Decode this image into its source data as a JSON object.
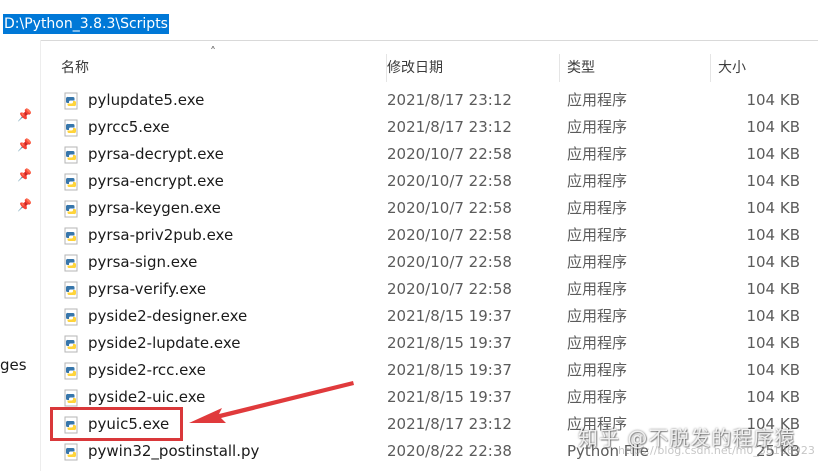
{
  "address_bar": {
    "path": "D:\\Python_3.8.3\\Scripts"
  },
  "nav": {
    "partial_label": "ges"
  },
  "columns": {
    "name": "名称",
    "date": "修改日期",
    "type": "类型",
    "size": "大小"
  },
  "files": [
    {
      "name": "pylupdate5.exe",
      "date": "2021/8/17 23:12",
      "type": "应用程序",
      "size": "104 KB"
    },
    {
      "name": "pyrcc5.exe",
      "date": "2021/8/17 23:12",
      "type": "应用程序",
      "size": "104 KB"
    },
    {
      "name": "pyrsa-decrypt.exe",
      "date": "2020/10/7 22:58",
      "type": "应用程序",
      "size": "104 KB"
    },
    {
      "name": "pyrsa-encrypt.exe",
      "date": "2020/10/7 22:58",
      "type": "应用程序",
      "size": "104 KB"
    },
    {
      "name": "pyrsa-keygen.exe",
      "date": "2020/10/7 22:58",
      "type": "应用程序",
      "size": "104 KB"
    },
    {
      "name": "pyrsa-priv2pub.exe",
      "date": "2020/10/7 22:58",
      "type": "应用程序",
      "size": "104 KB"
    },
    {
      "name": "pyrsa-sign.exe",
      "date": "2020/10/7 22:58",
      "type": "应用程序",
      "size": "104 KB"
    },
    {
      "name": "pyrsa-verify.exe",
      "date": "2020/10/7 22:58",
      "type": "应用程序",
      "size": "104 KB"
    },
    {
      "name": "pyside2-designer.exe",
      "date": "2021/8/15 19:37",
      "type": "应用程序",
      "size": "104 KB"
    },
    {
      "name": "pyside2-lupdate.exe",
      "date": "2021/8/15 19:37",
      "type": "应用程序",
      "size": "104 KB"
    },
    {
      "name": "pyside2-rcc.exe",
      "date": "2021/8/15 19:37",
      "type": "应用程序",
      "size": "104 KB"
    },
    {
      "name": "pyside2-uic.exe",
      "date": "2021/8/15 19:37",
      "type": "应用程序",
      "size": "104 KB"
    },
    {
      "name": "pyuic5.exe",
      "date": "2021/8/17 23:12",
      "type": "应用程序",
      "size": "104 KB"
    },
    {
      "name": "pywin32_postinstall.py",
      "date": "2020/8/22 22:38",
      "type": "Python File",
      "size": "25 KB"
    }
  ],
  "watermark": {
    "text": "知乎 @不脱发的程序猿",
    "url": "https://blog.csdn.net/m0_38106923"
  },
  "colors": {
    "selection": "#0078d7",
    "highlight": "#d9383a",
    "python_blue": "#3776ab",
    "python_yellow": "#ffd43b"
  }
}
